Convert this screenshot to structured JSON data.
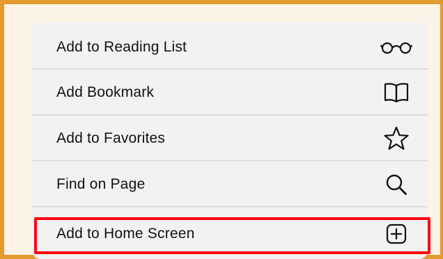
{
  "menu": {
    "items": [
      {
        "label": "Add to Reading List",
        "icon": "glasses-icon"
      },
      {
        "label": "Add Bookmark",
        "icon": "book-icon"
      },
      {
        "label": "Add to Favorites",
        "icon": "star-icon"
      },
      {
        "label": "Find on Page",
        "icon": "search-icon"
      },
      {
        "label": "Add to Home Screen",
        "icon": "plus-square-icon"
      }
    ]
  },
  "colors": {
    "frame_border": "#E39A2E",
    "frame_background": "#FBF3E5",
    "menu_background": "#F2F2F3",
    "separator": "#DDDDDF",
    "highlight": "#FF0010",
    "text": "#111111"
  }
}
